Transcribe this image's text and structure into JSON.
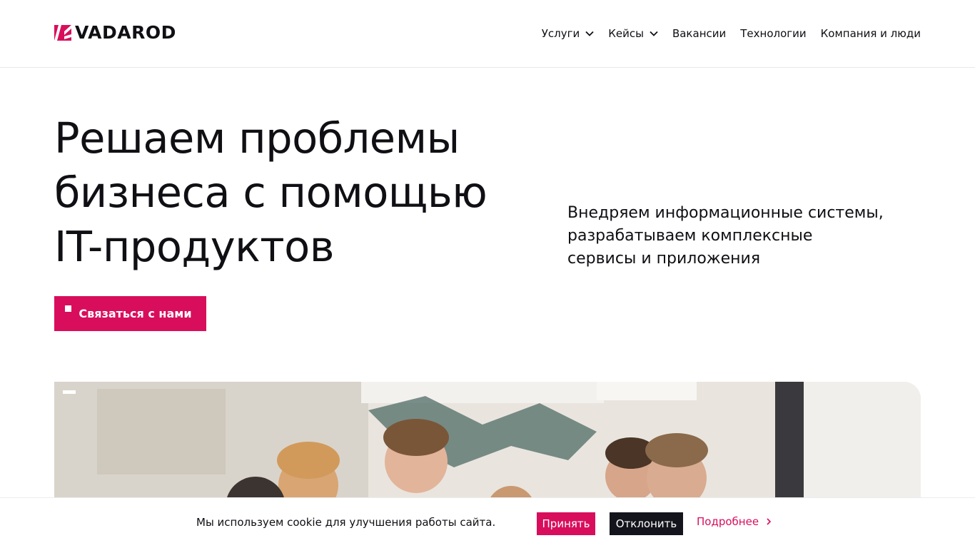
{
  "header": {
    "logo_text": "VADAROD",
    "nav": [
      {
        "label": "Услуги",
        "has_dropdown": true
      },
      {
        "label": "Кейсы",
        "has_dropdown": true
      },
      {
        "label": "Вакансии",
        "has_dropdown": false
      },
      {
        "label": "Технологии",
        "has_dropdown": false
      },
      {
        "label": "Компания и люди",
        "has_dropdown": false
      }
    ]
  },
  "hero": {
    "title_lines": [
      "Решаем проблемы",
      "бизнеса с помощью",
      "IT-продуктов"
    ],
    "subtitle_lines": [
      "Внедряем информационные системы,",
      "разрабатываем комплексные",
      "сервисы и приложения"
    ],
    "cta_label": "Связаться с нами"
  },
  "cookie_bar": {
    "text": "Мы используем cookie для улучшения работы сайта.",
    "accept_label": "Принять",
    "decline_label": "Отклонить",
    "more_label": "Подробнее"
  },
  "colors": {
    "accent": "#d80e5d",
    "dark": "#14141d",
    "text": "#0f0f14"
  }
}
